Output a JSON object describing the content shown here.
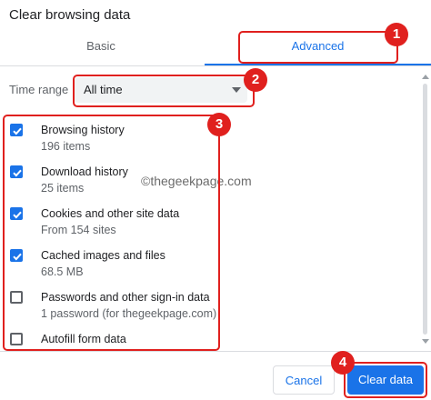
{
  "dialog": {
    "title": "Clear browsing data"
  },
  "tabs": [
    {
      "label": "Basic",
      "selected": false
    },
    {
      "label": "Advanced",
      "selected": true
    }
  ],
  "time_range": {
    "label": "Time range",
    "value": "All time"
  },
  "items": [
    {
      "title": "Browsing history",
      "subtitle": "196 items",
      "checked": true
    },
    {
      "title": "Download history",
      "subtitle": "25 items",
      "checked": true
    },
    {
      "title": "Cookies and other site data",
      "subtitle": "From 154 sites",
      "checked": true
    },
    {
      "title": "Cached images and files",
      "subtitle": "68.5 MB",
      "checked": true
    },
    {
      "title": "Passwords and other sign-in data",
      "subtitle": "1 password (for thegeekpage.com)",
      "checked": false
    },
    {
      "title": "Autofill form data",
      "subtitle": "",
      "checked": false
    }
  ],
  "watermark": "©thegeekpage.com",
  "buttons": {
    "cancel": "Cancel",
    "clear": "Clear data"
  },
  "annotations": [
    "1",
    "2",
    "3",
    "4"
  ],
  "colors": {
    "accent": "#1a73e8",
    "annotation": "#e0201e"
  }
}
